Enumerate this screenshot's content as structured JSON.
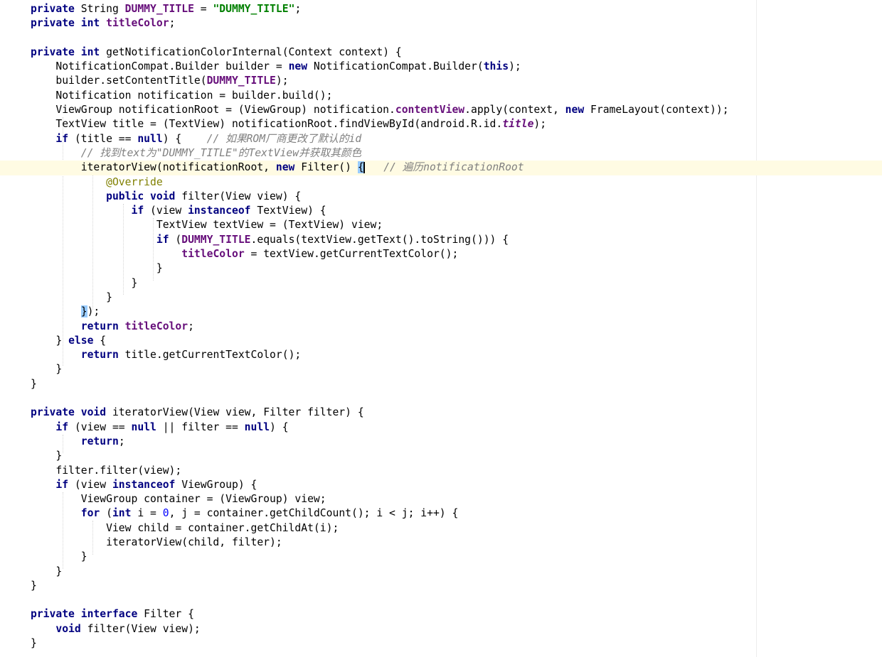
{
  "editor": {
    "language": "java",
    "current_line_index": 11,
    "lines": [
      [
        [
          "kw",
          "private"
        ],
        [
          "p",
          " String "
        ],
        [
          "fld",
          "DUMMY_TITLE"
        ],
        [
          "p",
          " = "
        ],
        [
          "str",
          "\"DUMMY_TITLE\""
        ],
        [
          "p",
          ";"
        ]
      ],
      [
        [
          "kw",
          "private"
        ],
        [
          "p",
          " "
        ],
        [
          "kw",
          "int"
        ],
        [
          "p",
          " "
        ],
        [
          "fld",
          "titleColor"
        ],
        [
          "p",
          ";"
        ]
      ],
      [],
      [
        [
          "kw",
          "private"
        ],
        [
          "p",
          " "
        ],
        [
          "kw",
          "int"
        ],
        [
          "p",
          " getNotificationColorInternal(Context context) {"
        ]
      ],
      [
        [
          "p",
          "    NotificationCompat.Builder builder = "
        ],
        [
          "kw",
          "new"
        ],
        [
          "p",
          " NotificationCompat.Builder("
        ],
        [
          "kw",
          "this"
        ],
        [
          "p",
          ");"
        ]
      ],
      [
        [
          "p",
          "    builder.setContentTitle("
        ],
        [
          "fld",
          "DUMMY_TITLE"
        ],
        [
          "p",
          ");"
        ]
      ],
      [
        [
          "p",
          "    Notification notification = builder.build();"
        ]
      ],
      [
        [
          "p",
          "    ViewGroup notificationRoot = (ViewGroup) notification."
        ],
        [
          "fld",
          "contentView"
        ],
        [
          "p",
          ".apply(context, "
        ],
        [
          "kw",
          "new"
        ],
        [
          "p",
          " FrameLayout(context));"
        ]
      ],
      [
        [
          "p",
          "    TextView title = (TextView) notificationRoot.findViewById(android.R.id."
        ],
        [
          "fld-i",
          "title"
        ],
        [
          "p",
          ");"
        ]
      ],
      [
        [
          "p",
          "    "
        ],
        [
          "kw",
          "if"
        ],
        [
          "p",
          " (title == "
        ],
        [
          "kw",
          "null"
        ],
        [
          "p",
          ") {    "
        ],
        [
          "cmt",
          "// 如果ROM厂商更改了默认的id"
        ]
      ],
      [
        [
          "p",
          "        "
        ],
        [
          "cmt",
          "// 找到text为\"DUMMY_TITLE\"的TextView并获取其颜色"
        ]
      ],
      [
        [
          "p",
          "        iteratorView(notificationRoot, "
        ],
        [
          "kw",
          "new"
        ],
        [
          "p",
          " Filter() "
        ],
        [
          "brace",
          "{"
        ],
        [
          "caret",
          ""
        ],
        [
          "p",
          "   "
        ],
        [
          "cmt",
          "// 遍历notificationRoot"
        ]
      ],
      [
        [
          "p",
          "            "
        ],
        [
          "ann",
          "@Override"
        ]
      ],
      [
        [
          "p",
          "            "
        ],
        [
          "kw",
          "public"
        ],
        [
          "p",
          " "
        ],
        [
          "kw",
          "void"
        ],
        [
          "p",
          " filter(View view) {"
        ]
      ],
      [
        [
          "p",
          "                "
        ],
        [
          "kw",
          "if"
        ],
        [
          "p",
          " (view "
        ],
        [
          "kw",
          "instanceof"
        ],
        [
          "p",
          " TextView) {"
        ]
      ],
      [
        [
          "p",
          "                    TextView textView = (TextView) view;"
        ]
      ],
      [
        [
          "p",
          "                    "
        ],
        [
          "kw",
          "if"
        ],
        [
          "p",
          " ("
        ],
        [
          "fld",
          "DUMMY_TITLE"
        ],
        [
          "p",
          ".equals(textView.getText().toString())) {"
        ]
      ],
      [
        [
          "p",
          "                        "
        ],
        [
          "fld",
          "titleColor"
        ],
        [
          "p",
          " = textView.getCurrentTextColor();"
        ]
      ],
      [
        [
          "p",
          "                    }"
        ]
      ],
      [
        [
          "p",
          "                }"
        ]
      ],
      [
        [
          "p",
          "            }"
        ]
      ],
      [
        [
          "p",
          "        "
        ],
        [
          "brace",
          "}"
        ],
        [
          "p",
          ");"
        ]
      ],
      [
        [
          "p",
          "        "
        ],
        [
          "kw",
          "return"
        ],
        [
          "p",
          " "
        ],
        [
          "fld",
          "titleColor"
        ],
        [
          "p",
          ";"
        ]
      ],
      [
        [
          "p",
          "    } "
        ],
        [
          "kw",
          "else"
        ],
        [
          "p",
          " {"
        ]
      ],
      [
        [
          "p",
          "        "
        ],
        [
          "kw",
          "return"
        ],
        [
          "p",
          " title.getCurrentTextColor();"
        ]
      ],
      [
        [
          "p",
          "    }"
        ]
      ],
      [
        [
          "p",
          "}"
        ]
      ],
      [],
      [
        [
          "kw",
          "private"
        ],
        [
          "p",
          " "
        ],
        [
          "kw",
          "void"
        ],
        [
          "p",
          " iteratorView(View view, Filter filter) {"
        ]
      ],
      [
        [
          "p",
          "    "
        ],
        [
          "kw",
          "if"
        ],
        [
          "p",
          " (view == "
        ],
        [
          "kw",
          "null"
        ],
        [
          "p",
          " || filter == "
        ],
        [
          "kw",
          "null"
        ],
        [
          "p",
          ") {"
        ]
      ],
      [
        [
          "p",
          "        "
        ],
        [
          "kw",
          "return"
        ],
        [
          "p",
          ";"
        ]
      ],
      [
        [
          "p",
          "    }"
        ]
      ],
      [
        [
          "p",
          "    filter.filter(view);"
        ]
      ],
      [
        [
          "p",
          "    "
        ],
        [
          "kw",
          "if"
        ],
        [
          "p",
          " (view "
        ],
        [
          "kw",
          "instanceof"
        ],
        [
          "p",
          " ViewGroup) {"
        ]
      ],
      [
        [
          "p",
          "        ViewGroup container = (ViewGroup) view;"
        ]
      ],
      [
        [
          "p",
          "        "
        ],
        [
          "kw",
          "for"
        ],
        [
          "p",
          " ("
        ],
        [
          "kw",
          "int"
        ],
        [
          "p",
          " i = "
        ],
        [
          "num",
          "0"
        ],
        [
          "p",
          ", j = container.getChildCount(); i < j; i++) {"
        ]
      ],
      [
        [
          "p",
          "            View child = container.getChildAt(i);"
        ]
      ],
      [
        [
          "p",
          "            iteratorView(child, filter);"
        ]
      ],
      [
        [
          "p",
          "        }"
        ]
      ],
      [
        [
          "p",
          "    }"
        ]
      ],
      [
        [
          "p",
          "}"
        ]
      ],
      [],
      [
        [
          "kw",
          "private"
        ],
        [
          "p",
          " "
        ],
        [
          "kw",
          "interface"
        ],
        [
          "p",
          " Filter {"
        ]
      ],
      [
        [
          "p",
          "    "
        ],
        [
          "kw",
          "void"
        ],
        [
          "p",
          " filter(View view);"
        ]
      ],
      [
        [
          "p",
          "}"
        ]
      ]
    ]
  },
  "gutter": {
    "icon": "lightbulb-icon",
    "icon_color": "#f0c030"
  },
  "colors": {
    "keyword": "#000080",
    "field": "#660e7a",
    "string": "#008000",
    "number": "#0000ff",
    "comment": "#808080",
    "annotation": "#808000",
    "current_line": "#fffbe3",
    "brace_match": "#99ccff"
  }
}
